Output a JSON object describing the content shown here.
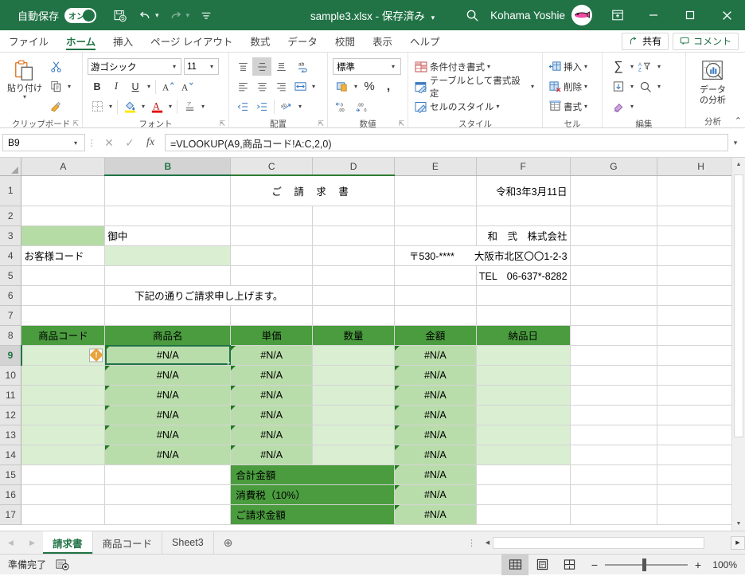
{
  "titlebar": {
    "autosave_label": "自動保存",
    "autosave_state": "オン",
    "doc_title": "sample3.xlsx - 保存済み",
    "user_name": "Kohama Yoshie",
    "icons": [
      "save-icon",
      "undo-icon",
      "redo-icon",
      "customize-qat-icon",
      "search-icon",
      "ribbon-display-icon",
      "minimize-icon",
      "maximize-icon",
      "close-icon"
    ]
  },
  "ribbon_tabs": [
    {
      "label": "ファイル",
      "active": false
    },
    {
      "label": "ホーム",
      "active": true
    },
    {
      "label": "挿入",
      "active": false
    },
    {
      "label": "ページ レイアウト",
      "active": false
    },
    {
      "label": "数式",
      "active": false
    },
    {
      "label": "データ",
      "active": false
    },
    {
      "label": "校閲",
      "active": false
    },
    {
      "label": "表示",
      "active": false
    },
    {
      "label": "ヘルプ",
      "active": false
    }
  ],
  "ribbon_right": {
    "share_label": "共有",
    "comment_label": "コメント"
  },
  "ribbon": {
    "clipboard": {
      "group_label": "クリップボード",
      "paste_label": "貼り付け",
      "cut_label": "切り取り",
      "copy_label": "コピー",
      "format_painter_label": "書式のコピー/貼り付け"
    },
    "font": {
      "group_label": "フォント",
      "font_name": "游ゴシック",
      "font_size": "11",
      "bold": "B",
      "italic": "I",
      "underline": "U",
      "grow_font": "A",
      "shrink_font": "A",
      "border_label": "罫線",
      "fill_label": "塗りつぶしの色",
      "fontcolor_label": "フォントの色",
      "phonetic_label": "ふりがなの表示/非表示"
    },
    "alignment": {
      "group_label": "配置",
      "align_top": "上揃え",
      "align_middle": "上下中央揃え",
      "align_bottom": "下揃え",
      "wrap_text": "折り返して全体を表示する",
      "align_left": "左揃え",
      "align_center": "中央揃え",
      "align_right": "右揃え",
      "merge_center": "セルを結合して中央揃え",
      "decrease_indent": "インデントを減らす",
      "increase_indent": "インデントを増やす",
      "orientation": "方向"
    },
    "number": {
      "group_label": "数値",
      "format": "標準",
      "currency": "通貨表示形式",
      "percent": "%",
      "comma": "桁区切りスタイル",
      "decrease_decimal": "小数点以下の表示桁数を減らす",
      "increase_decimal": "小数点以下の表示桁数を増やす"
    },
    "styles": {
      "group_label": "スタイル",
      "conditional_formatting": "条件付き書式",
      "format_as_table": "テーブルとして書式設定",
      "cell_styles": "セルのスタイル"
    },
    "cells": {
      "group_label": "セル",
      "insert": "挿入",
      "delete": "削除",
      "format": "書式"
    },
    "editing": {
      "group_label": "編集",
      "autosum": "オート SUM",
      "sort_filter": "並べ替えとフィルター",
      "fill": "フィル",
      "find_select": "検索と選択",
      "clear": "クリア"
    },
    "analysis": {
      "group_label": "分析",
      "data_analysis_line1": "データ",
      "data_analysis_line2": "の分析"
    }
  },
  "formula_bar": {
    "name_box": "B9",
    "cancel_icon": "cancel-icon",
    "enter_icon": "enter-icon",
    "function_icon": "insert-function-icon",
    "formula": "=VLOOKUP(A9,商品コード!A:C,2,0)"
  },
  "grid": {
    "columns": [
      "A",
      "B",
      "C",
      "D",
      "E",
      "F",
      "G",
      "H"
    ],
    "selected_column": "B",
    "selected_row": "9",
    "rows": [
      "1",
      "2",
      "3",
      "4",
      "5",
      "6",
      "7",
      "8",
      "9",
      "10",
      "11",
      "12",
      "13",
      "14",
      "15",
      "16",
      "17"
    ],
    "cells": {
      "title": "ご 請 求 書",
      "date": "令和3年3月11日",
      "onchu": "御中",
      "customer_code_label": "お客様コード",
      "company": "和　弐　株式会社",
      "zip": "〒530-****　　大阪市北区〇〇1-2-3",
      "tel": "TEL　06-637*-8282",
      "intro": "下記の通りご請求申し上げます。",
      "header_product_code": "商品コード",
      "header_product_name": "商品名",
      "header_unit_price": "単価",
      "header_quantity": "数量",
      "header_amount": "金額",
      "header_delivery_date": "納品日",
      "na": "#N/A",
      "total_label": "合計金額",
      "tax_label": "消費税（10%）",
      "billed_label": "ご請求金額"
    },
    "warning_icon": "error-warning-icon"
  },
  "sheet_tabs": [
    {
      "label": "請求書",
      "active": true
    },
    {
      "label": "商品コード",
      "active": false
    },
    {
      "label": "Sheet3",
      "active": false
    }
  ],
  "add_sheet_label": "⊕",
  "statusbar": {
    "status": "準備完了",
    "accessibility_icon": "accessibility-icon",
    "views": [
      "normal-view-icon",
      "page-layout-icon",
      "page-break-preview-icon"
    ],
    "zoom_minus": "−",
    "zoom_plus": "+",
    "zoom_level": "100%"
  },
  "colors": {
    "brand_green": "#217346",
    "header_green": "#4a9c3e",
    "fill_dark": "#b6dca6",
    "fill_light": "#daeed2"
  }
}
